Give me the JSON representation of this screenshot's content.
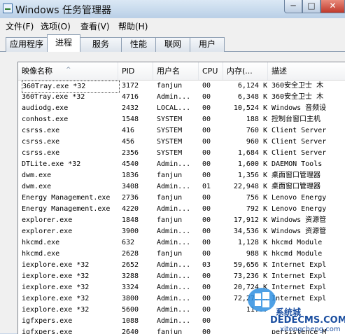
{
  "window": {
    "title": "Windows 任务管理器",
    "minimize_label": "─",
    "maximize_label": "□",
    "close_label": "✕"
  },
  "menu": [
    "文件(F)",
    "选项(O)",
    "查看(V)",
    "帮助(H)"
  ],
  "tabs": [
    "应用程序",
    "进程",
    "服务",
    "性能",
    "联网",
    "用户"
  ],
  "active_tab": "进程",
  "columns": {
    "name": "映像名称",
    "pid": "PID",
    "user": "用户名",
    "cpu": "CPU",
    "mem": "内存(...",
    "desc": "描述"
  },
  "sort_indicator": "^",
  "processes": [
    {
      "name": "360Tray.exe *32",
      "pid": "3172",
      "user": "fanjun",
      "cpu": "00",
      "mem": "6,124 K",
      "desc": "360安全卫士 木"
    },
    {
      "name": "360Tray.exe *32",
      "pid": "4716",
      "user": "Admin...",
      "cpu": "00",
      "mem": "6,348 K",
      "desc": "360安全卫士 木"
    },
    {
      "name": "audiodg.exe",
      "pid": "2432",
      "user": "LOCAL...",
      "cpu": "00",
      "mem": "10,524 K",
      "desc": "Windows 音频设"
    },
    {
      "name": "conhost.exe",
      "pid": "1548",
      "user": "SYSTEM",
      "cpu": "00",
      "mem": "188 K",
      "desc": "控制台窗口主机"
    },
    {
      "name": "csrss.exe",
      "pid": "416",
      "user": "SYSTEM",
      "cpu": "00",
      "mem": "760 K",
      "desc": "Client Server"
    },
    {
      "name": "csrss.exe",
      "pid": "456",
      "user": "SYSTEM",
      "cpu": "00",
      "mem": "960 K",
      "desc": "Client Server"
    },
    {
      "name": "csrss.exe",
      "pid": "2356",
      "user": "SYSTEM",
      "cpu": "00",
      "mem": "1,684 K",
      "desc": "Client Server"
    },
    {
      "name": "DTLite.exe *32",
      "pid": "4540",
      "user": "Admin...",
      "cpu": "00",
      "mem": "1,600 K",
      "desc": "DAEMON Tools"
    },
    {
      "name": "dwm.exe",
      "pid": "1836",
      "user": "fanjun",
      "cpu": "00",
      "mem": "1,356 K",
      "desc": "桌面窗口管理器"
    },
    {
      "name": "dwm.exe",
      "pid": "3408",
      "user": "Admin...",
      "cpu": "01",
      "mem": "22,948 K",
      "desc": "桌面窗口管理器"
    },
    {
      "name": "Energy Management.exe",
      "pid": "2736",
      "user": "fanjun",
      "cpu": "00",
      "mem": "756 K",
      "desc": "Lenovo Energy"
    },
    {
      "name": "Energy Management.exe",
      "pid": "4220",
      "user": "Admin...",
      "cpu": "00",
      "mem": "792 K",
      "desc": "Lenovo Energy"
    },
    {
      "name": "explorer.exe",
      "pid": "1848",
      "user": "fanjun",
      "cpu": "00",
      "mem": "17,912 K",
      "desc": "Windows 资源管"
    },
    {
      "name": "explorer.exe",
      "pid": "3900",
      "user": "Admin...",
      "cpu": "00",
      "mem": "34,536 K",
      "desc": "Windows 资源管"
    },
    {
      "name": "hkcmd.exe",
      "pid": "632",
      "user": "Admin...",
      "cpu": "00",
      "mem": "1,128 K",
      "desc": "hkcmd Module"
    },
    {
      "name": "hkcmd.exe",
      "pid": "2628",
      "user": "fanjun",
      "cpu": "00",
      "mem": "988 K",
      "desc": "hkcmd Module"
    },
    {
      "name": "iexplore.exe *32",
      "pid": "2652",
      "user": "Admin...",
      "cpu": "03",
      "mem": "59,656 K",
      "desc": "Internet Expl"
    },
    {
      "name": "iexplore.exe *32",
      "pid": "3288",
      "user": "Admin...",
      "cpu": "00",
      "mem": "73,236 K",
      "desc": "Internet Expl"
    },
    {
      "name": "iexplore.exe *32",
      "pid": "3324",
      "user": "Admin...",
      "cpu": "00",
      "mem": "20,724 K",
      "desc": "Internet Expl"
    },
    {
      "name": "iexplore.exe *32",
      "pid": "3800",
      "user": "Admin...",
      "cpu": "00",
      "mem": "72,272 K",
      "desc": "Internet Expl"
    },
    {
      "name": "iexplore.exe *32",
      "pid": "5600",
      "user": "Admin...",
      "cpu": "00",
      "mem": "11...",
      "desc": ""
    },
    {
      "name": "igfxpers.exe",
      "pid": "1088",
      "user": "Admin...",
      "cpu": "00",
      "mem": "",
      "desc": ""
    },
    {
      "name": "igfxpers.exe",
      "pid": "2640",
      "user": "fanjun",
      "cpu": "00",
      "mem": "",
      "desc": "persistence M"
    }
  ],
  "watermark": {
    "site": "系统城",
    "brand": "DEDECMS.COM",
    "url": "xitongcheng.com"
  },
  "colors": {
    "titlebar": "#c9d7e8",
    "close": "#c0392b",
    "watermark": "#1c4fa0"
  }
}
